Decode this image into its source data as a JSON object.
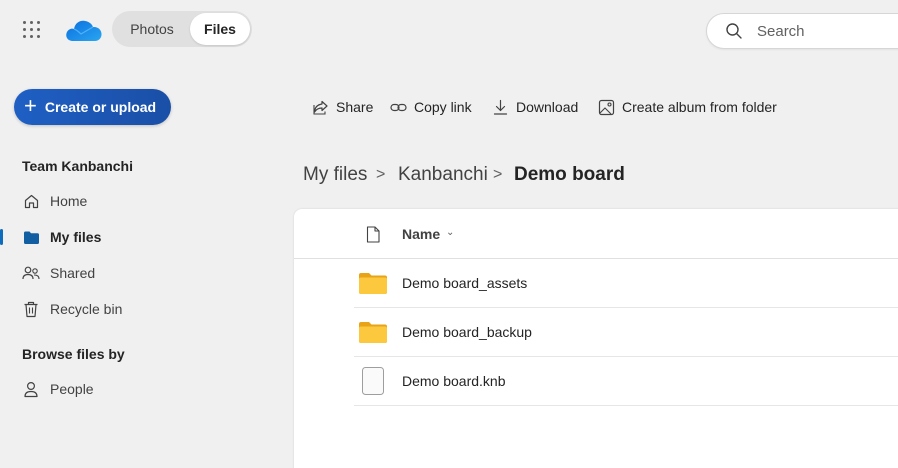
{
  "topbar": {
    "app_launcher_icon": "waffle-grid-icon",
    "logo_icon": "onedrive-cloud-logo",
    "tabs": [
      {
        "label": "Photos",
        "selected": false
      },
      {
        "label": "Files",
        "selected": true
      }
    ],
    "search": {
      "placeholder": "Search",
      "icon": "search-icon"
    }
  },
  "create_button": {
    "label": "Create or upload",
    "icon": "plus-icon"
  },
  "sidebar": {
    "section_title": "Team Kanbanchi",
    "items": [
      {
        "label": "Home",
        "icon": "home-icon",
        "active": false
      },
      {
        "label": "My files",
        "icon": "folder-icon",
        "active": true
      },
      {
        "label": "Shared",
        "icon": "people-icon",
        "active": false
      },
      {
        "label": "Recycle bin",
        "icon": "trash-icon",
        "active": false
      }
    ],
    "browse_title": "Browse files by",
    "browse_items": [
      {
        "label": "People",
        "icon": "person-icon"
      }
    ]
  },
  "toolbar": {
    "share": "Share",
    "copy_link": "Copy link",
    "download": "Download",
    "create_album": "Create album from folder"
  },
  "breadcrumb": {
    "items": [
      "My files",
      "Kanbanchi",
      "Demo board"
    ],
    "separator": ">"
  },
  "file_list": {
    "header": {
      "name": "Name",
      "sort_icon": "chevron-down-icon"
    },
    "rows": [
      {
        "name": "Demo board_assets",
        "type": "folder"
      },
      {
        "name": "Demo board_backup",
        "type": "folder"
      },
      {
        "name": "Demo board.knb",
        "type": "file"
      }
    ]
  },
  "colors": {
    "accent": "#0f6cbd",
    "create_button": "#1f5fc4",
    "folder": "#f2c12e",
    "background": "#f0f0f0"
  }
}
